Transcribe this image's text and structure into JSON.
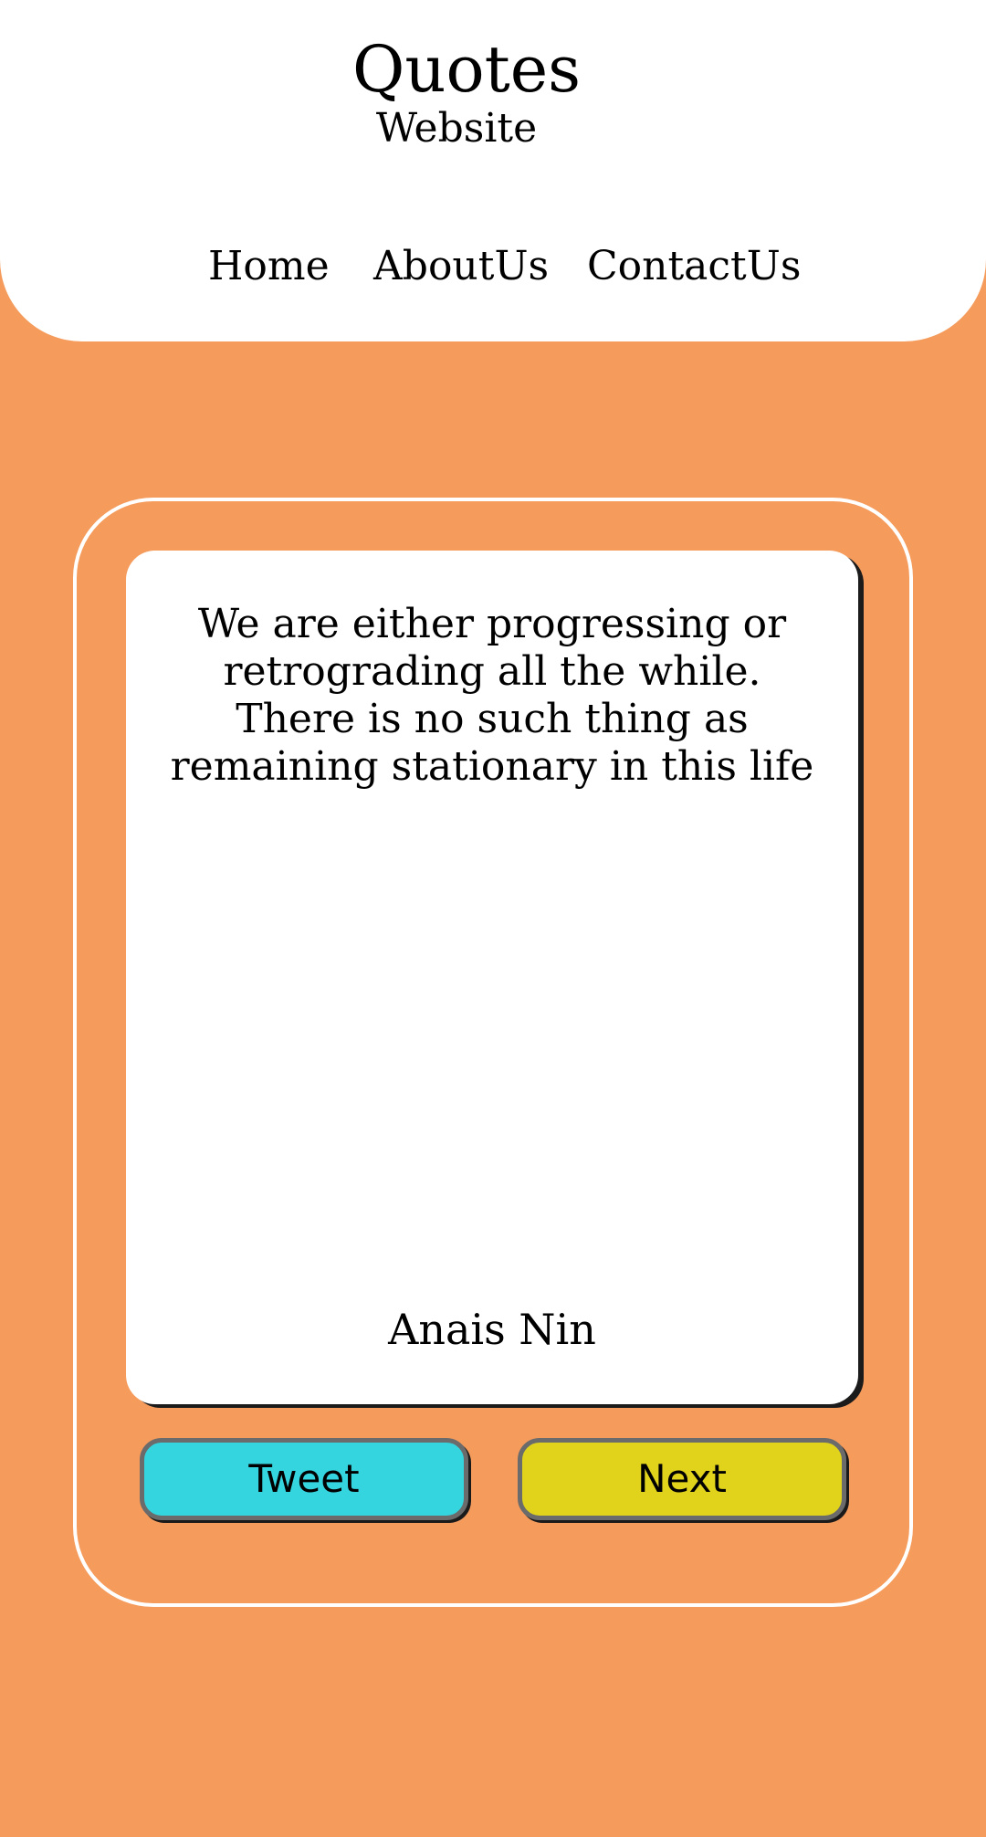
{
  "header": {
    "title": "Quotes",
    "subtitle": "Website",
    "nav": [
      {
        "label": "Home"
      },
      {
        "label": "AboutUs"
      },
      {
        "label": "ContactUs"
      }
    ]
  },
  "quote": {
    "text": "We are either progressing or retrograding all the while. There is no such thing as remaining stationary in this life",
    "author": "Anais Nin"
  },
  "actions": {
    "tweet_label": "Tweet",
    "next_label": "Next"
  },
  "colors": {
    "background": "#F59B5C",
    "tweet_button": "#35D5E0",
    "next_button": "#E1D21B",
    "card": "#FFFFFF"
  }
}
